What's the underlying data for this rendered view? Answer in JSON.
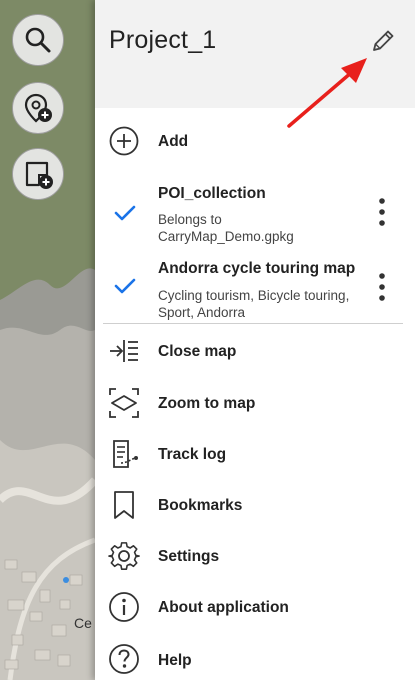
{
  "map": {
    "label": "Ce"
  },
  "floating": [
    {
      "name": "search-button",
      "icon": "search-icon"
    },
    {
      "name": "add-poi-button",
      "icon": "add-poi-icon"
    },
    {
      "name": "add-note-button",
      "icon": "add-note-icon"
    }
  ],
  "drawer": {
    "title": "Project_1",
    "edit_icon": "pencil-icon",
    "add_label": "Add",
    "layers": [
      {
        "title": "POI_collection",
        "subtitle": [
          "Belongs to",
          "CarryMap_Demo.gpkg"
        ],
        "checked": true
      },
      {
        "title": "Andorra cycle touring map",
        "subtitle": [
          "Cycling tourism, Bicycle touring,",
          "Sport, Andorra"
        ],
        "checked": true
      }
    ],
    "menu": [
      {
        "label": "Close map",
        "icon": "close-map-icon"
      },
      {
        "label": "Zoom to map",
        "icon": "zoom-to-map-icon"
      },
      {
        "label": "Track log",
        "icon": "track-log-icon"
      },
      {
        "label": "Bookmarks",
        "icon": "bookmark-icon"
      },
      {
        "label": "Settings",
        "icon": "gear-icon"
      },
      {
        "label": "About application",
        "icon": "info-icon"
      },
      {
        "label": "Help",
        "icon": "help-icon"
      }
    ]
  },
  "colors": {
    "accent": "#1a73e8",
    "annotation_arrow": "#e8201c",
    "header_bg": "#f2f2f2"
  }
}
